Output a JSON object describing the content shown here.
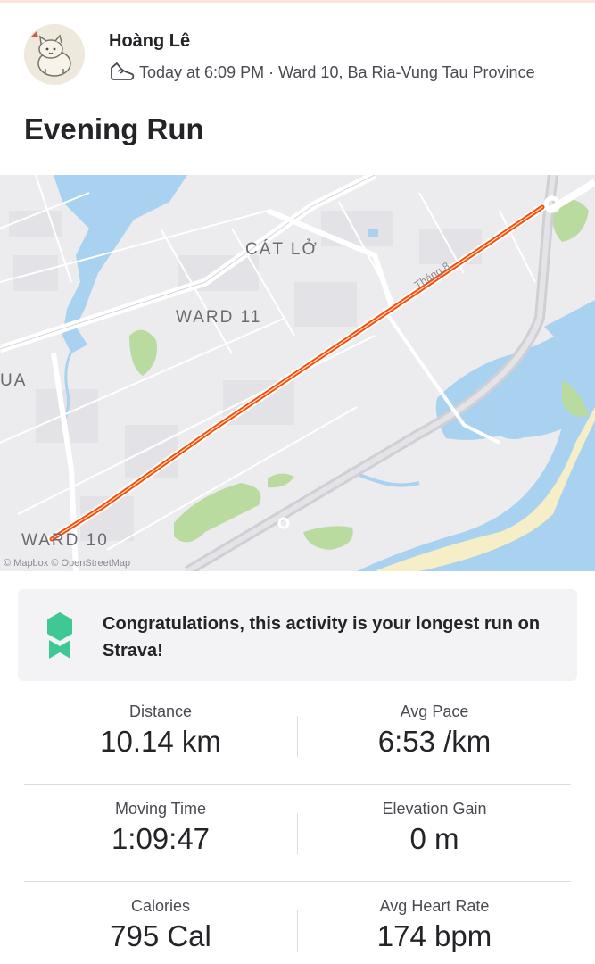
{
  "athlete": {
    "name": "Hoàng Lê",
    "avatar_icon": "cat-avatar-icon",
    "activity_icon": "shoe-icon"
  },
  "meta": {
    "time": "Today at 6:09 PM",
    "separator": " · ",
    "location": "Ward 10, Ba Ria-Vung Tau Province"
  },
  "activity": {
    "title": "Evening Run"
  },
  "map": {
    "labels": {
      "cat_lo": "CÁT LỞ",
      "ward_11": "WARD 11",
      "ua": "UA",
      "ward_10": "WARD 10",
      "street": "Tháng 8"
    },
    "attribution": "© Mapbox © OpenStreetMap",
    "route_color": "#fc4c02",
    "water_color": "#a8d2ef",
    "park_color": "#b9dba0"
  },
  "achievement": {
    "text": "Congratulations, this activity is your longest run on Strava!",
    "badge_icon": "award-badge-icon",
    "badge_color": "#3ec893"
  },
  "stats": [
    {
      "label": "Distance",
      "value": "10.14 km"
    },
    {
      "label": "Avg Pace",
      "value": "6:53 /km"
    },
    {
      "label": "Moving Time",
      "value": "1:09:47"
    },
    {
      "label": "Elevation Gain",
      "value": "0 m"
    },
    {
      "label": "Calories",
      "value": "795 Cal"
    },
    {
      "label": "Avg Heart Rate",
      "value": "174 bpm"
    }
  ]
}
